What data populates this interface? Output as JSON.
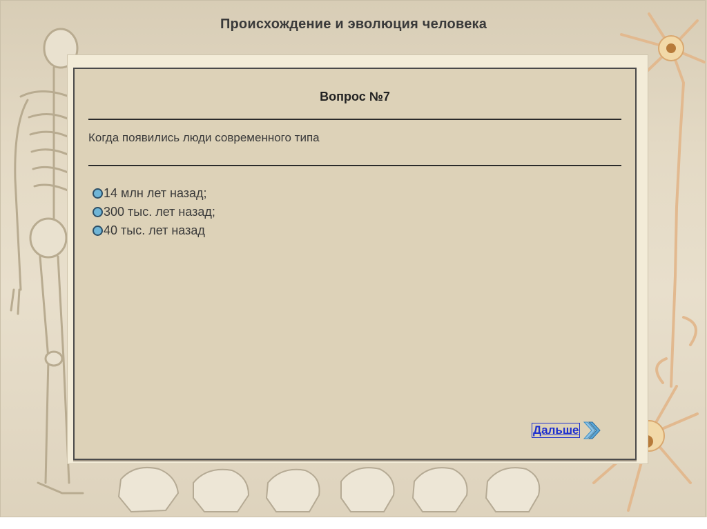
{
  "page": {
    "title": "Происхождение и эволюция человека"
  },
  "question": {
    "heading": "Вопрос №7",
    "text": "Когда появились люди современного типа"
  },
  "answers": [
    {
      "label": "14 млн лет назад;"
    },
    {
      "label": "300 тыс. лет назад;"
    },
    {
      "label": "40 тыс. лет назад"
    }
  ],
  "navigation": {
    "next_label": "Дальше"
  },
  "colors": {
    "background": "#e4dac5",
    "panel": "#ddd2b8",
    "radio_fill": "#6fb5d6",
    "link": "#1d2fcf",
    "arrow": "#3f8fc2"
  },
  "icons": {
    "next": "double-chevron-right-icon",
    "skeleton": "skeleton-illustration",
    "neuron": "neuron-illustration",
    "skulls": "skull-row-illustration"
  }
}
